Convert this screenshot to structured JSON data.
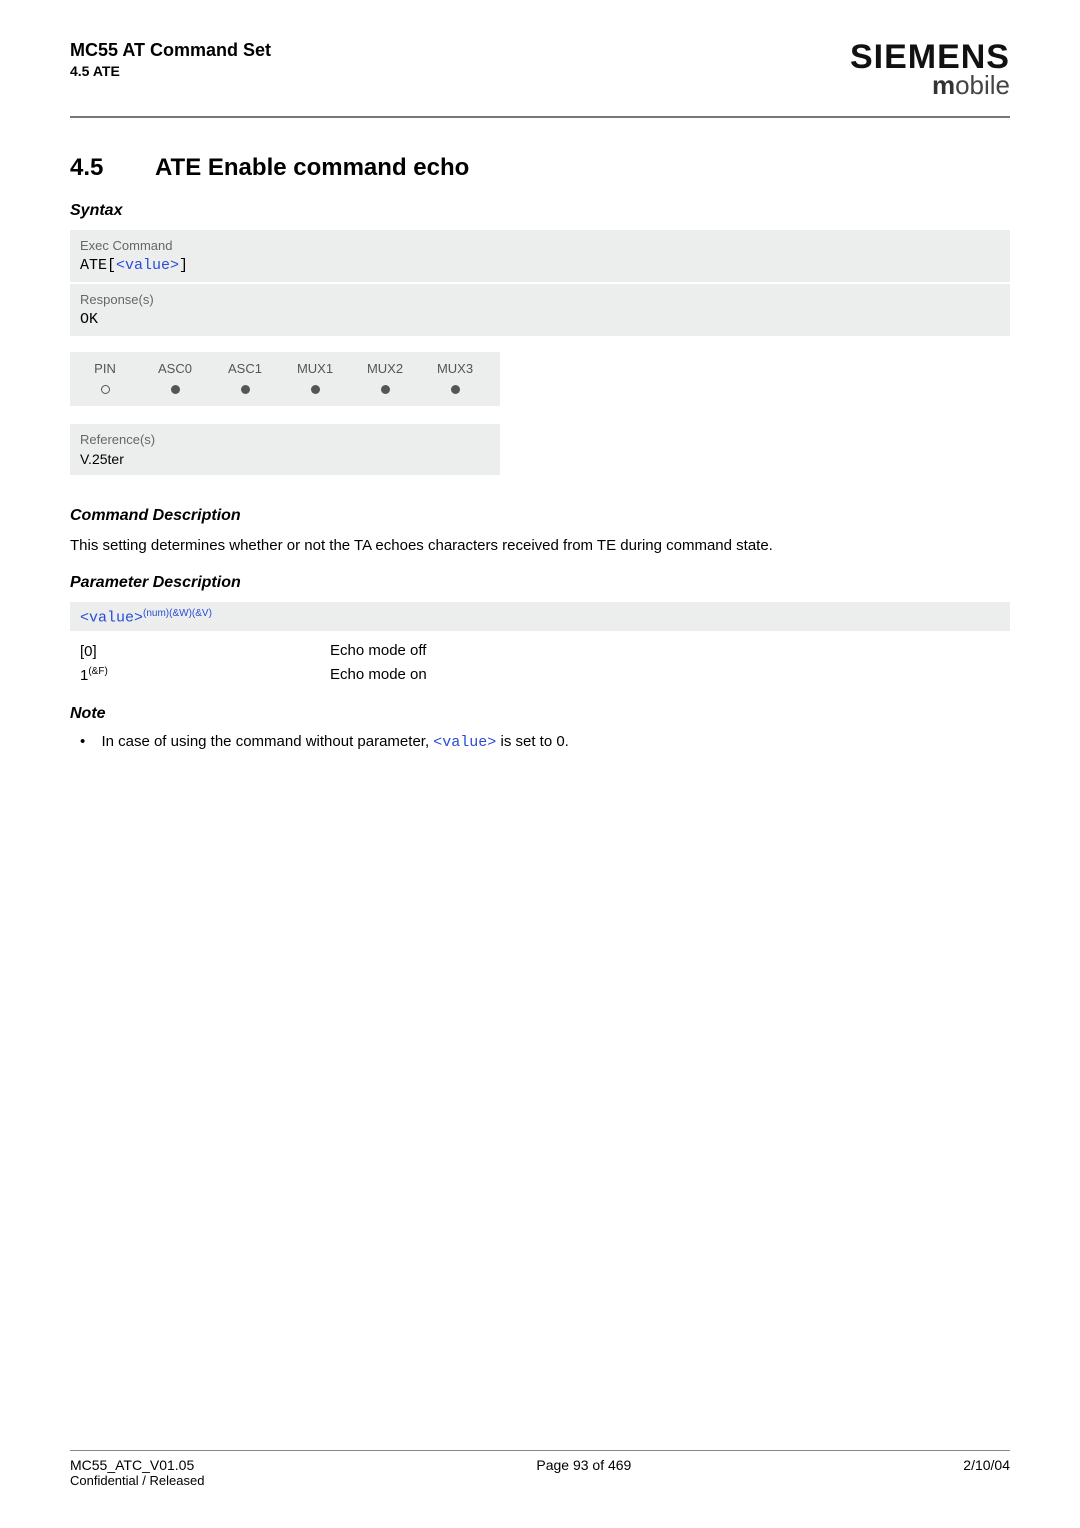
{
  "header": {
    "title": "MC55 AT Command Set",
    "subtitle": "4.5 ATE",
    "brand_top": "SIEMENS",
    "brand_bottom_m": "m",
    "brand_bottom_rest": "obile"
  },
  "section": {
    "number": "4.5",
    "title": "ATE   Enable command echo"
  },
  "syntax_label": "Syntax",
  "exec": {
    "label": "Exec Command",
    "cmd_prefix": "ATE",
    "cmd_open": "[",
    "cmd_param": "<value>",
    "cmd_close": "]"
  },
  "response": {
    "label": "Response(s)",
    "text": "OK"
  },
  "attr": {
    "headers": [
      "PIN",
      "ASC0",
      "ASC1",
      "MUX1",
      "MUX2",
      "MUX3"
    ],
    "values": [
      "empty",
      "full",
      "full",
      "full",
      "full",
      "full"
    ]
  },
  "reference": {
    "label": "Reference(s)",
    "text": "V.25ter"
  },
  "cmd_desc_label": "Command Description",
  "cmd_desc_text": "This setting determines whether or not the TA echoes characters received from TE during command state.",
  "param_desc_label": "Parameter Description",
  "param_header": {
    "name": "<value>",
    "sup": "(num)(&W)(&V)"
  },
  "param_values": [
    {
      "key": "[0]",
      "key_sup": "",
      "desc": "Echo mode off"
    },
    {
      "key": "1",
      "key_sup": "(&F)",
      "desc": "Echo mode on"
    }
  ],
  "note_label": "Note",
  "note_pre": "In case of using the command without parameter, ",
  "note_param": "<value>",
  "note_post": " is set to 0.",
  "footer": {
    "left_top": "MC55_ATC_V01.05",
    "left_bottom": "Confidential / Released",
    "center": "Page 93 of 469",
    "right": "2/10/04"
  }
}
